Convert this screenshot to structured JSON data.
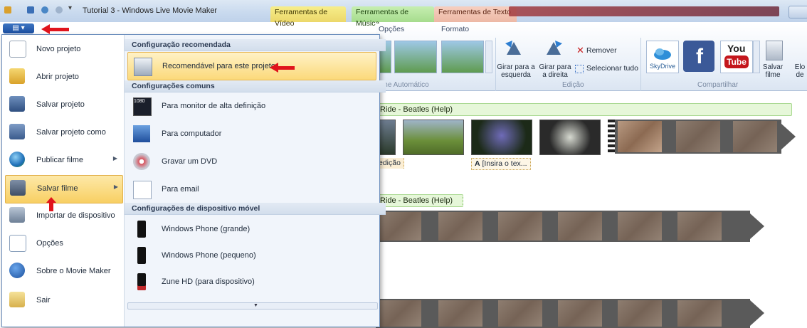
{
  "window": {
    "title": "Tutorial 3 - Windows Live Movie Maker",
    "context_tabs": [
      "Ferramentas de Vídeo",
      "Ferramentas de Música",
      "Ferramentas de Texto"
    ]
  },
  "ribbon": {
    "tabs": [
      "Opções",
      "Formato"
    ],
    "groups": [
      {
        "label": "Filme Automático"
      },
      {
        "label": "Edição",
        "buttons": [
          "Girar para a esquerda",
          "Girar para a direita"
        ],
        "remove": "Remover",
        "select_all": "Selecionar tudo"
      },
      {
        "label": "Compartilhar",
        "skydrive": "SkyDrive",
        "youtube_top": "You",
        "youtube_bottom": "Tube",
        "save_movie": "Salvar filme",
        "extra": "Elo de"
      }
    ]
  },
  "storyboard": {
    "music_caption_1": "Ride - Beatles (Help)",
    "music_caption_2": "Ride - Beatles (Help)",
    "caption_tag": "edição",
    "text_tag_icon": "A",
    "text_tag": "[Insira o tex..."
  },
  "file_menu": {
    "left_items": [
      {
        "label": "Novo projeto",
        "icon": "new-project-icon"
      },
      {
        "label": "Abrir projeto",
        "icon": "open-folder-icon"
      },
      {
        "label": "Salvar projeto",
        "icon": "save-icon"
      },
      {
        "label": "Salvar projeto como",
        "icon": "save-as-icon"
      },
      {
        "label": "Publicar filme",
        "icon": "globe-icon",
        "submenu": "▶"
      },
      {
        "label": "Salvar filme",
        "icon": "film-save-icon",
        "submenu": "▶"
      },
      {
        "label": "Importar de dispositivo",
        "icon": "camera-import-icon"
      },
      {
        "label": "Opções",
        "icon": "options-icon"
      },
      {
        "label": "Sobre o Movie Maker",
        "icon": "info-icon"
      },
      {
        "label": "Sair",
        "icon": "exit-icon"
      }
    ],
    "sections": {
      "recommended": "Configuração recomendada",
      "common": "Configurações comuns",
      "mobile": "Configurações de dispositivo móvel"
    },
    "right_items": {
      "recommended": "Recomendável para este projeto",
      "hd_monitor": "Para monitor de alta definição",
      "hd_badge": "1080",
      "computer": "Para computador",
      "dvd": "Gravar um DVD",
      "email": "Para email",
      "wp_large": "Windows Phone (grande)",
      "wp_small": "Windows Phone (pequeno)",
      "zune": "Zune HD (para dispositivo)"
    },
    "scroll_arrow": "▼"
  },
  "colors": {
    "accent_red": "#e0141c",
    "menu_highlight": "#f8cf63",
    "ribbon_blue": "#1b4ea0"
  }
}
